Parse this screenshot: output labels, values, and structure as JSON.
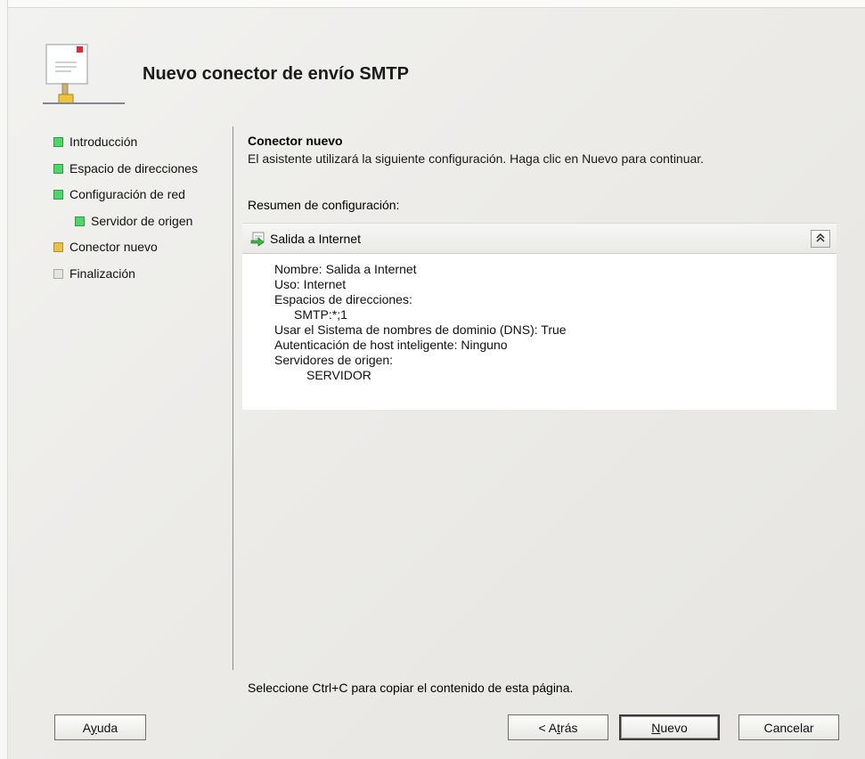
{
  "header": {
    "title": "Nuevo conector de envío SMTP",
    "icon": "mail-connector-icon"
  },
  "nav": {
    "items": [
      {
        "label": "Introducción",
        "status": "complete",
        "color": "#4fd66a"
      },
      {
        "label": "Espacio de direcciones",
        "status": "complete",
        "color": "#4fd66a"
      },
      {
        "label": "Configuración de red",
        "status": "complete",
        "color": "#4fd66a"
      },
      {
        "label": "Servidor de origen",
        "status": "complete",
        "color": "#4fd66a",
        "indent": true
      },
      {
        "label": "Conector nuevo",
        "status": "current",
        "color": "#e8c14d"
      },
      {
        "label": "Finalización",
        "status": "pending",
        "color": "#e4e4e4"
      }
    ]
  },
  "main": {
    "heading": "Conector nuevo",
    "description": "El asistente utilizará la siguiente configuración. Haga clic en Nuevo para continuar.",
    "summary_label": "Resumen de configuración:",
    "panel": {
      "title": "Salida a Internet",
      "collapse_glyph": "≈",
      "lines": [
        "Nombre: Salida a Internet",
        "Uso: Internet",
        "Espacios de direcciones:",
        "SMTP:*;1",
        "Usar el Sistema de nombres de dominio (DNS): True",
        "Autenticación de host inteligente: Ninguno",
        "Servidores de origen:",
        "SERVIDOR"
      ]
    },
    "hint": "Seleccione Ctrl+C para copiar el contenido de esta página."
  },
  "buttons": {
    "help": {
      "label": "Ayuda",
      "accel": "y"
    },
    "back": {
      "label": "< Atrás",
      "accel": "t"
    },
    "next": {
      "label": "Nuevo",
      "accel": "N"
    },
    "cancel": {
      "label": "Cancelar"
    }
  }
}
